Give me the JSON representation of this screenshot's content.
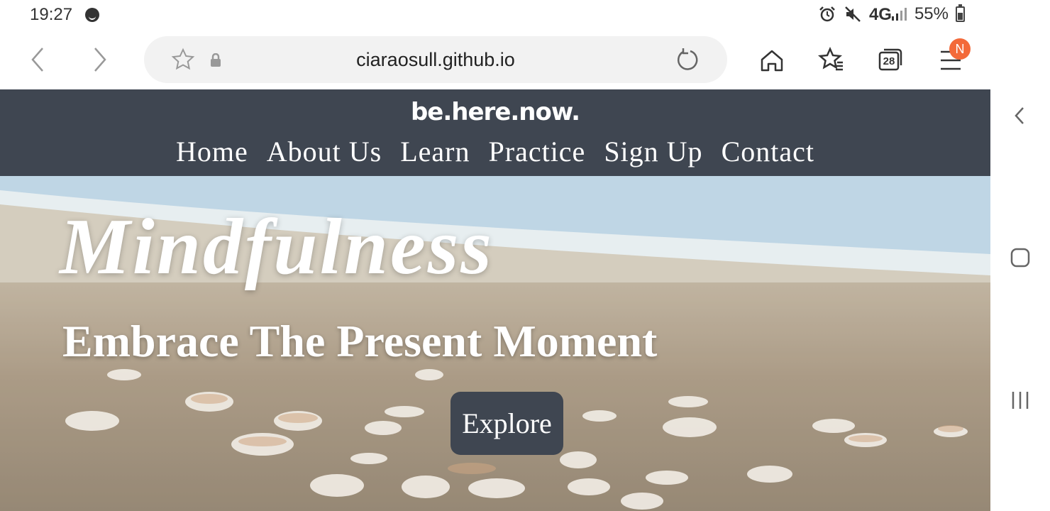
{
  "status_bar": {
    "time": "19:27",
    "network": "4G",
    "battery": "55%"
  },
  "browser": {
    "url": "ciaraosull.github.io",
    "tab_count": "28",
    "menu_badge": "N"
  },
  "site": {
    "brand": "be.here.now.",
    "nav": [
      "Home",
      "About Us",
      "Learn",
      "Practice",
      "Sign Up",
      "Contact"
    ],
    "hero_title": "Mindfulness",
    "hero_subtitle": "Embrace The Present Moment",
    "cta_label": "Explore"
  },
  "colors": {
    "header_bg": "#3f4651",
    "badge": "#f36a3a"
  },
  "icons": [
    "back-icon",
    "forward-icon",
    "star-icon",
    "lock-icon",
    "reload-icon",
    "home-icon",
    "bookmarks-icon",
    "tabs-icon",
    "menu-icon",
    "alarm-icon",
    "mute-icon",
    "signal-icon",
    "battery-icon",
    "collapse-icon",
    "home-button-icon",
    "recents-icon"
  ]
}
